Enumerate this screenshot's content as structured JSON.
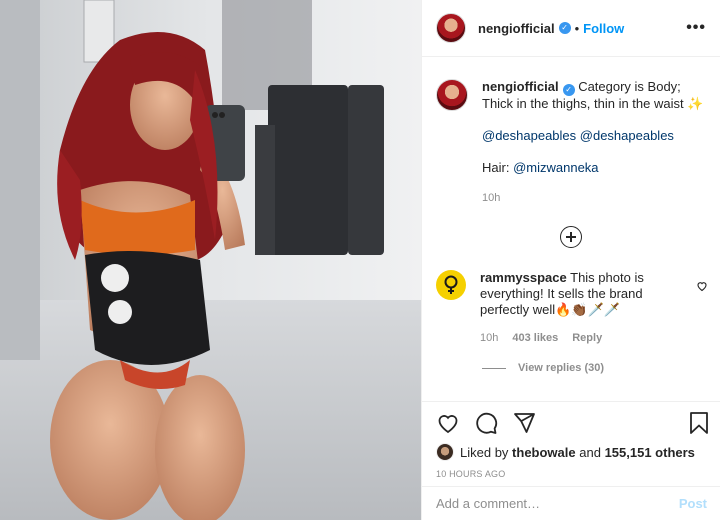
{
  "post": {
    "username": "nengiofficial",
    "follow_label": "Follow",
    "dot": "•",
    "more_label": "•••",
    "caption_text": "Category is Body; Thick in the thighs, thin in the waist ✨",
    "mentions": "@deshapeables @deshapeables",
    "hair_label": "Hair:",
    "hair_mention": "@mizwanneka",
    "time": "10h"
  },
  "comment": {
    "username": "rammysspace",
    "text": "This photo is everything! It sells the brand perfectly well🔥👏🏾🗡️🗡️",
    "time": "10h",
    "likes": "403 likes",
    "reply_label": "Reply",
    "view_replies": "View replies (30)"
  },
  "likes": {
    "prefix": "Liked by",
    "user": "thebowale",
    "middle": "and",
    "count": "155,151 others"
  },
  "timestamp": "10 HOURS AGO",
  "comment_box": {
    "placeholder": "Add a comment…",
    "post_label": "Post"
  },
  "colors": {
    "accent": "#0095f6",
    "verified": "#3897f0",
    "post_disabled": "#b2dffc",
    "comment_avatar": "#f5d000"
  },
  "icons": [
    "verified-icon",
    "more-icon",
    "add-comment-icon",
    "heart-icon",
    "comment-icon",
    "share-icon",
    "save-icon",
    "small-heart-icon"
  ]
}
